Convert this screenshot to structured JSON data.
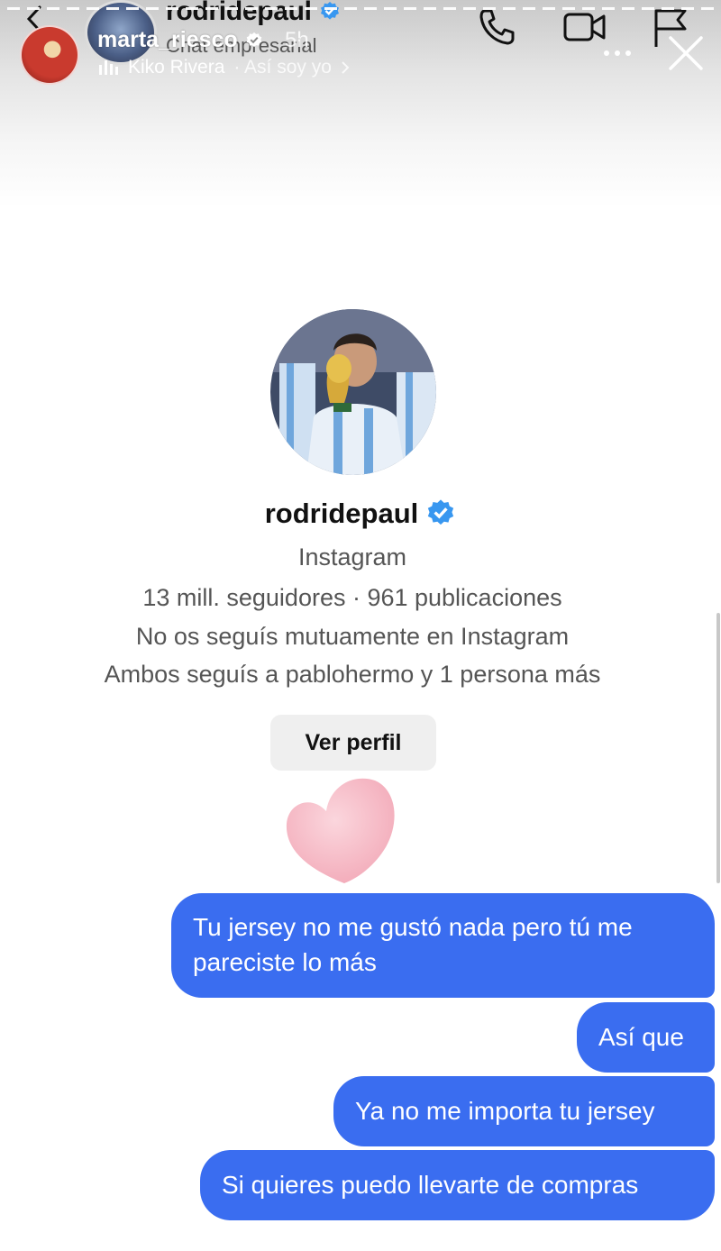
{
  "colors": {
    "accent_blue": "#3a6df0",
    "verified_blue": "#3897f0",
    "button_bg": "#efefef",
    "heart_pink": "#f6b8c4"
  },
  "dm_header": {
    "title": "rodridepaul",
    "subtitle": "Chat empresarial",
    "icons": [
      "back-icon",
      "phone-icon",
      "video-camera-icon",
      "flag-icon"
    ]
  },
  "story": {
    "username": "marta_riesco",
    "time": "5h",
    "music_artist": "Kiko Rivera",
    "music_song": "· Así soy yo",
    "icons": [
      "music-bars-icon",
      "more-icon",
      "close-icon"
    ]
  },
  "profile": {
    "name": "rodridepaul",
    "platform": "Instagram",
    "stats": "13 mill. seguidores · 961 publicaciones",
    "mutual_status": "No os seguís mutuamente en Instagram",
    "mutual_follows": "Ambos seguís a pablohermo y 1 persona más",
    "view_profile_label": "Ver perfil"
  },
  "messages": [
    {
      "text": "Tu jersey no me gustó nada pero tú me pareciste lo más"
    },
    {
      "text": "Así que"
    },
    {
      "text": "Ya no me importa tu jersey"
    },
    {
      "text": "Si quieres puedo llevarte de compras"
    }
  ]
}
